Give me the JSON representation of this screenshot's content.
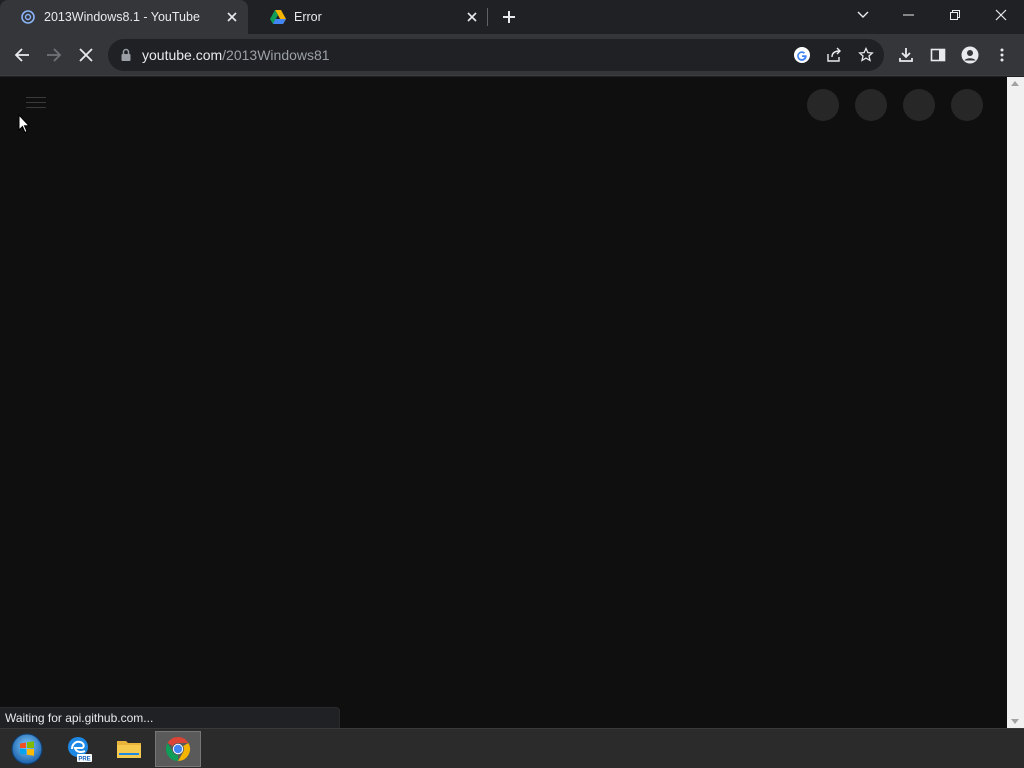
{
  "tabs": [
    {
      "title": "2013Windows8.1 - YouTube",
      "favicon": "webcam-icon",
      "active": true
    },
    {
      "title": "Error",
      "favicon": "google-drive-icon",
      "active": false
    }
  ],
  "toolbar": {
    "url_host": "youtube.com",
    "url_path": "/2013Windows81",
    "loading": true
  },
  "status_text": "Waiting for api.github.com...",
  "page": {
    "theme": "#0f0f0f",
    "skeleton_avatar_count": 4
  },
  "taskbar": {
    "items": [
      {
        "name": "start-button",
        "icon": "windows-orb-icon"
      },
      {
        "name": "edge-preview",
        "icon": "edge-pre-icon",
        "badge": "PRE"
      },
      {
        "name": "file-explorer",
        "icon": "folder-icon"
      },
      {
        "name": "chrome",
        "icon": "chrome-icon",
        "active": true
      }
    ]
  },
  "colors": {
    "accent_chrome_red": "#db4437",
    "accent_chrome_green": "#0f9d58",
    "accent_chrome_yellow": "#f4b400",
    "accent_chrome_blue": "#4285f4"
  }
}
